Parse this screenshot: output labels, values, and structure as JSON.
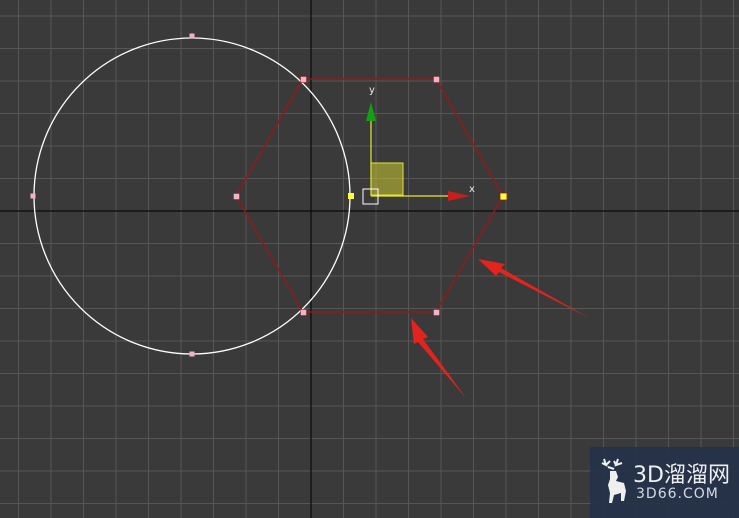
{
  "viewport": {
    "name": "3D modeling viewport (top view)",
    "background_color": "#3a3a3a",
    "grid_color": "#565656",
    "home_grid_axis_color": "#0a0a0a"
  },
  "objects": {
    "circle": {
      "stroke_color": "#ffffff",
      "vertex_color": "#f0b4c8"
    },
    "hexagon": {
      "stroke_color": "#8c1c1c",
      "vertex_color": "#f0b4c8",
      "selected_vertex_color": "#ffff33"
    }
  },
  "gizmo": {
    "x_label": "x",
    "y_label": "y",
    "y_axis_color": "#14a014",
    "x_axis_color": "#c81e1e",
    "plane_color": "#c8c832"
  },
  "annotations": {
    "arrow_color": "#e3231e",
    "count": 2
  },
  "watermark": {
    "brand_cn": "3D溜溜网",
    "brand_en": "3D66.COM",
    "logo_icon": "deer-logo-icon"
  }
}
